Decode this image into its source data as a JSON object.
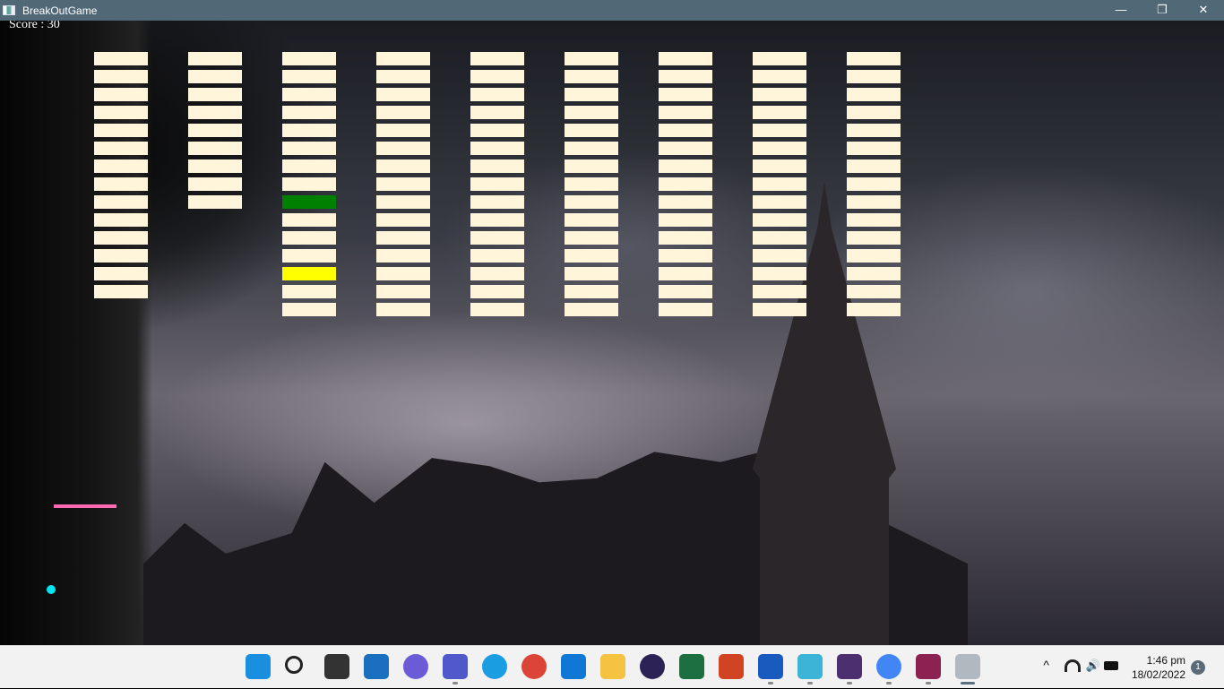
{
  "window": {
    "title": "BreakOutGame",
    "minimize": "—",
    "maximize": "❐",
    "close": "✕"
  },
  "game": {
    "score_label": "Score : 30",
    "score": 30,
    "bricks": {
      "columns": 9,
      "rows_per_column": [
        14,
        9,
        15,
        15,
        15,
        15,
        15,
        15,
        15
      ],
      "default_color": "#fff5da",
      "special": [
        {
          "column": 3,
          "row": 9,
          "color": "#008000"
        },
        {
          "column": 3,
          "row": 13,
          "color": "#ffff00"
        }
      ]
    },
    "paddle_color": "#ff69b4",
    "ball_color": "#00e5ee"
  },
  "taskbar": {
    "apps": [
      {
        "name": "start",
        "color": "#1a8fe0",
        "running": false
      },
      {
        "name": "search",
        "color": "#222",
        "running": false
      },
      {
        "name": "task-view",
        "color": "#333",
        "running": false
      },
      {
        "name": "widgets",
        "color": "#1a6fc0",
        "running": false
      },
      {
        "name": "teams-chat",
        "color": "#6b5bd6",
        "running": false
      },
      {
        "name": "teams",
        "color": "#5059c9",
        "running": true
      },
      {
        "name": "edge",
        "color": "#1b9de2",
        "running": false
      },
      {
        "name": "chrome",
        "color": "#db4437",
        "running": false
      },
      {
        "name": "mail",
        "color": "#0f78d4",
        "running": false
      },
      {
        "name": "file-explorer",
        "color": "#f5c242",
        "running": false
      },
      {
        "name": "eclipse",
        "color": "#2c2255",
        "running": false
      },
      {
        "name": "excel",
        "color": "#1d6f42",
        "running": false
      },
      {
        "name": "powerpoint",
        "color": "#d04423",
        "running": false
      },
      {
        "name": "word",
        "color": "#185abd",
        "running": true
      },
      {
        "name": "notepad",
        "color": "#3bb4d8",
        "running": true
      },
      {
        "name": "java-ee-ide",
        "color": "#4b2f6e",
        "running": true
      },
      {
        "name": "chrome-profile",
        "color": "#4285f4",
        "running": true
      },
      {
        "name": "winrar",
        "color": "#8b2252",
        "running": true
      },
      {
        "name": "java-app",
        "color": "#b0b8c0",
        "running": true
      }
    ],
    "tray": {
      "chevron": "^",
      "wifi": "wifi",
      "volume": "🔊",
      "battery": "🔌",
      "time": "1:46 pm",
      "date": "18/02/2022",
      "notifications": "1"
    }
  }
}
